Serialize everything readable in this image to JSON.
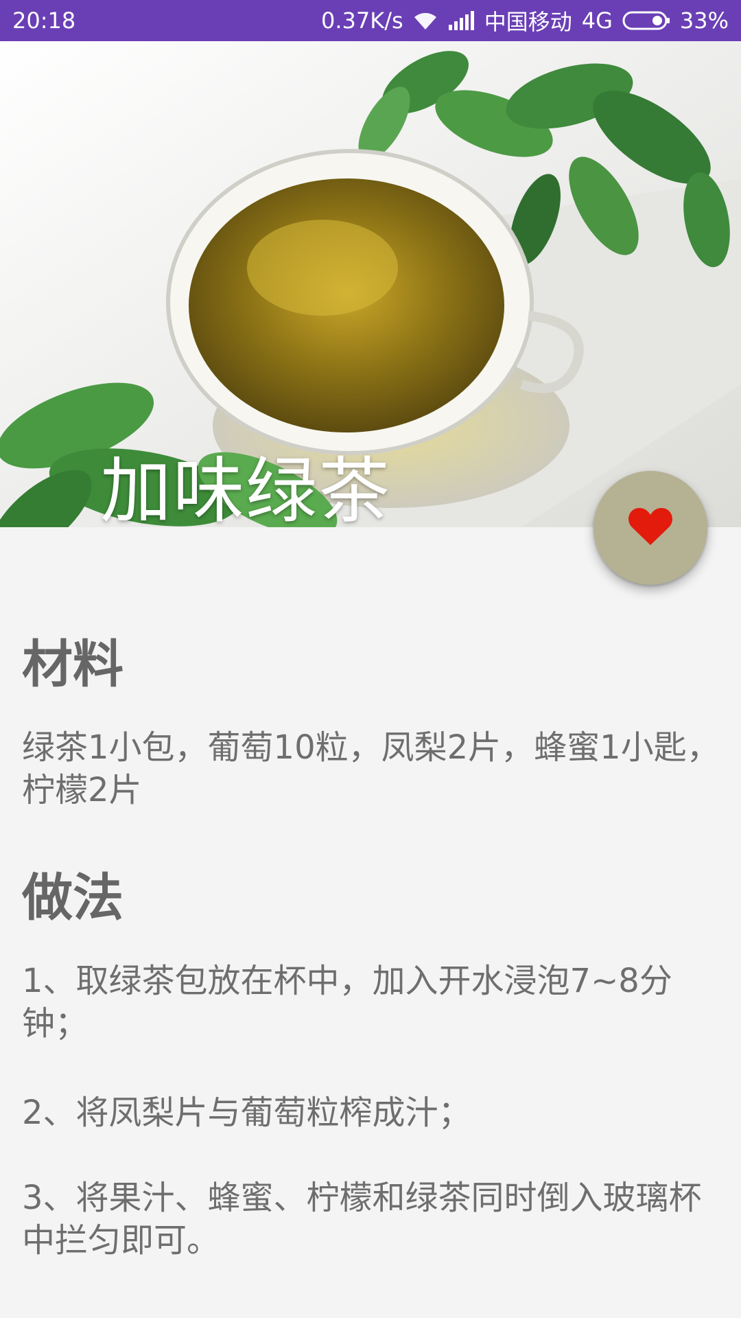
{
  "status_bar": {
    "time": "20:18",
    "net_speed": "0.37K/s",
    "carrier": "中国移动",
    "network": "4G",
    "battery": "33%"
  },
  "recipe": {
    "title": "加味绿茶",
    "materials_heading": "材料",
    "materials": "绿茶1小包，葡萄10粒，凤梨2片，蜂蜜1小匙，柠檬2片",
    "method_heading": "做法",
    "steps": [
      "1、取绿茶包放在杯中，加入开水浸泡7~8分钟；",
      "2、将凤梨片与葡萄粒榨成汁；",
      "3、将果汁、蜂蜜、柠檬和绿茶同时倒入玻璃杯中拦匀即可。"
    ]
  },
  "fab": {
    "icon": "heart-icon",
    "color": "#e21b0c"
  },
  "colors": {
    "status_bar": "#6a3fb5",
    "fab_bg": "#b5b193",
    "background": "#f4f4f4"
  }
}
